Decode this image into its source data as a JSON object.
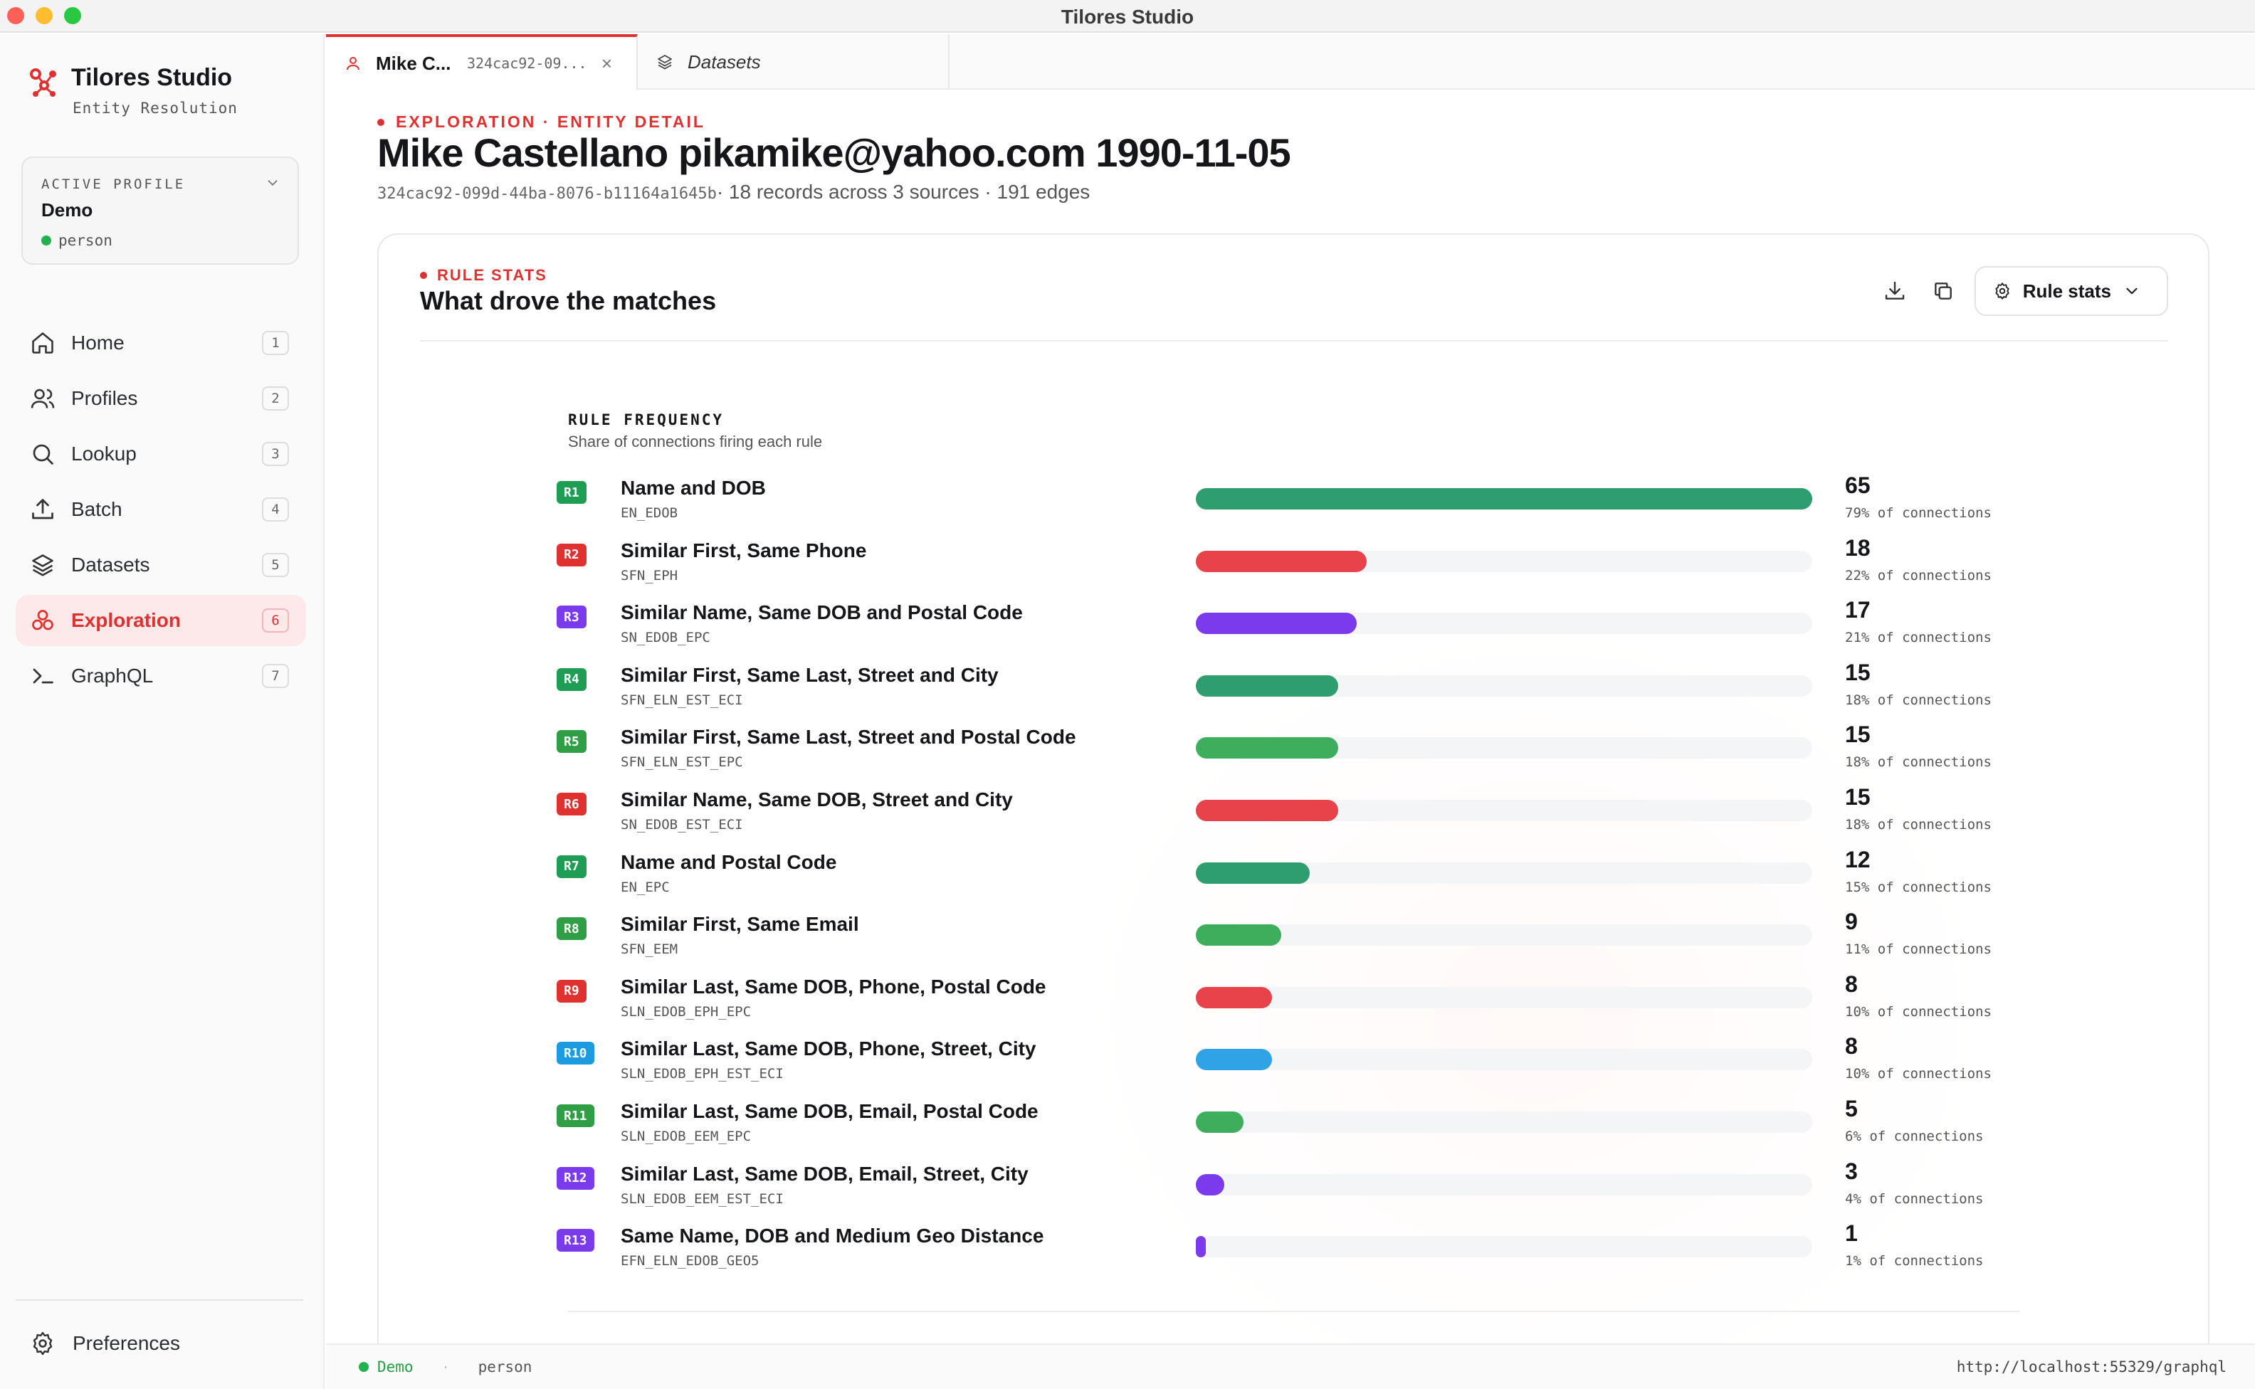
{
  "window": {
    "title": "Tilores Studio"
  },
  "sidebar": {
    "brand_name": "Tilores Studio",
    "brand_sub": "Entity Resolution",
    "profile": {
      "label": "ACTIVE PROFILE",
      "name": "Demo",
      "type": "person"
    },
    "items": [
      {
        "label": "Home",
        "badge": "1",
        "icon": "home-icon"
      },
      {
        "label": "Profiles",
        "badge": "2",
        "icon": "users-icon"
      },
      {
        "label": "Lookup",
        "badge": "3",
        "icon": "search-icon"
      },
      {
        "label": "Batch",
        "badge": "4",
        "icon": "upload-icon"
      },
      {
        "label": "Datasets",
        "badge": "5",
        "icon": "layers-icon"
      },
      {
        "label": "Exploration",
        "badge": "6",
        "icon": "network-icon",
        "active": true
      },
      {
        "label": "GraphQL",
        "badge": "7",
        "icon": "terminal-icon"
      }
    ],
    "preferences_label": "Preferences"
  },
  "tabs": [
    {
      "title": "Mike C...",
      "id": "324cac92-09...",
      "close": "×",
      "icon": "person-icon"
    },
    {
      "title": "Datasets",
      "icon": "layers-icon"
    }
  ],
  "main": {
    "eyebrow": "EXPLORATION · ENTITY DETAIL",
    "headline": "Mike Castellano pikamike@yahoo.com 1990-11-05",
    "entity_id": "324cac92-099d-44ba-8076-b11164a1645b",
    "meta_text": " · 18 records across 3 sources · 191 edges"
  },
  "card": {
    "eyebrow": "RULE STATS",
    "title": "What drove the matches",
    "dropdown_label": "Rule stats",
    "freq_title": "RULE FREQUENCY",
    "freq_sub": "Share of connections firing each rule"
  },
  "colors": {
    "accent": "#e03131",
    "teal": "#2f9e6e",
    "red": "#e8424a",
    "purple": "#7c3aed",
    "green": "#3cae5c",
    "blue": "#2fa3e6",
    "badge_green": "#1f9d55"
  },
  "rules": [
    {
      "id": "R1",
      "name": "Name and DOB",
      "code": "EN_EDOB",
      "count": "65",
      "pct_label": "79% of connections",
      "value": 65,
      "color": "#2f9e6e",
      "badge": "#1f9d55"
    },
    {
      "id": "R2",
      "name": "Similar First, Same Phone",
      "code": "SFN_EPH",
      "count": "18",
      "pct_label": "22% of connections",
      "value": 18,
      "color": "#e8424a",
      "badge": "#e03131"
    },
    {
      "id": "R3",
      "name": "Similar Name, Same DOB and Postal Code",
      "code": "SN_EDOB_EPC",
      "count": "17",
      "pct_label": "21% of connections",
      "value": 17,
      "color": "#7c3aed",
      "badge": "#7c3aed"
    },
    {
      "id": "R4",
      "name": "Similar First, Same Last, Street and City",
      "code": "SFN_ELN_EST_ECI",
      "count": "15",
      "pct_label": "18% of connections",
      "value": 15,
      "color": "#2f9e6e",
      "badge": "#1f9d55"
    },
    {
      "id": "R5",
      "name": "Similar First, Same Last, Street and Postal Code",
      "code": "SFN_ELN_EST_EPC",
      "count": "15",
      "pct_label": "18% of connections",
      "value": 15,
      "color": "#3cae5c",
      "badge": "#2f9e44"
    },
    {
      "id": "R6",
      "name": "Similar Name, Same DOB, Street and City",
      "code": "SN_EDOB_EST_ECI",
      "count": "15",
      "pct_label": "18% of connections",
      "value": 15,
      "color": "#e8424a",
      "badge": "#e03131"
    },
    {
      "id": "R7",
      "name": "Name and Postal Code",
      "code": "EN_EPC",
      "count": "12",
      "pct_label": "15% of connections",
      "value": 12,
      "color": "#2f9e6e",
      "badge": "#1f9d55"
    },
    {
      "id": "R8",
      "name": "Similar First, Same Email",
      "code": "SFN_EEM",
      "count": "9",
      "pct_label": "11% of connections",
      "value": 9,
      "color": "#3cae5c",
      "badge": "#2f9e44"
    },
    {
      "id": "R9",
      "name": "Similar Last, Same DOB, Phone, Postal Code",
      "code": "SLN_EDOB_EPH_EPC",
      "count": "8",
      "pct_label": "10% of connections",
      "value": 8,
      "color": "#e8424a",
      "badge": "#e03131"
    },
    {
      "id": "R10",
      "name": "Similar Last, Same DOB, Phone, Street, City",
      "code": "SLN_EDOB_EPH_EST_ECI",
      "count": "8",
      "pct_label": "10% of connections",
      "value": 8,
      "color": "#2fa3e6",
      "badge": "#1c9be0"
    },
    {
      "id": "R11",
      "name": "Similar Last, Same DOB, Email, Postal Code",
      "code": "SLN_EDOB_EEM_EPC",
      "count": "5",
      "pct_label": "6% of connections",
      "value": 5,
      "color": "#3cae5c",
      "badge": "#2f9e44"
    },
    {
      "id": "R12",
      "name": "Similar Last, Same DOB, Email, Street, City",
      "code": "SLN_EDOB_EEM_EST_ECI",
      "count": "3",
      "pct_label": "4% of connections",
      "value": 3,
      "color": "#7c3aed",
      "badge": "#7c3aed"
    },
    {
      "id": "R13",
      "name": "Same Name, DOB and Medium Geo Distance",
      "code": "EFN_ELN_EDOB_GEO5",
      "count": "1",
      "pct_label": "1% of connections",
      "value": 1,
      "color": "#7c3aed",
      "badge": "#7c3aed"
    }
  ],
  "rules_max": 65,
  "statusbar": {
    "profile": "Demo",
    "separator": "·",
    "type": "person",
    "url": "http://localhost:55329/graphql"
  }
}
